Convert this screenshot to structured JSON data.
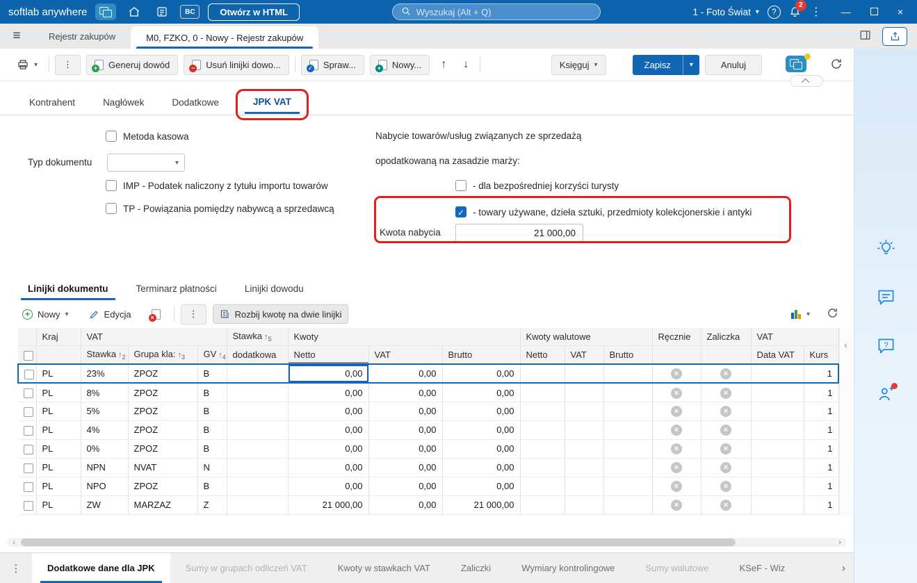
{
  "topbar": {
    "app_name": "softlab anywhere",
    "bc_icon_label": "BC",
    "open_html_label": "Otwórz w HTML",
    "search_placeholder": "Wyszukaj (Alt + Q)",
    "company_selector": "1 - Foto Świat",
    "notification_badge": "2"
  },
  "tabbar": {
    "tab_inactive": "Rejestr zakupów",
    "tab_active": "M0, FZKO, 0 - Nowy - Rejestr zakupów"
  },
  "toolbar": {
    "generuj_dowod": "Generuj dowód",
    "usun_linijki": "Usuń linijki dowo...",
    "sprawdz": "Spraw...",
    "nowy": "Nowy...",
    "ksieguj": "Księguj",
    "zapisz": "Zapisz",
    "anuluj": "Anuluj"
  },
  "form_tabs": {
    "items": [
      "Kontrahent",
      "Nagłówek",
      "Dodatkowe",
      "JPK VAT"
    ],
    "active": "JPK VAT"
  },
  "form": {
    "metoda_kasowa": "Metoda kasowa",
    "typ_dokumentu_label": "Typ dokumentu",
    "imp_label": "IMP - Podatek naliczony z tytułu importu towarów",
    "tp_label": "TP - Powiązania pomiędzy nabywcą a sprzedawcą",
    "marza_line1": "Nabycie towarów/usług związanych ze sprzedażą",
    "marza_line2": "opodatkowaną na zasadzie marży:",
    "turysta_label": "- dla bezpośredniej korzyści turysty",
    "towary_label": "- towary używane, dzieła sztuki, przedmioty kolekcjonerskie i antyki",
    "kwota_nabycia_label": "Kwota nabycia",
    "kwota_nabycia_value": "21 000,00"
  },
  "detail_tabs": {
    "items": [
      "Linijki dokumentu",
      "Terminarz płatności",
      "Linijki dowodu"
    ],
    "active": "Linijki dokumentu"
  },
  "toolbar2": {
    "nowy": "Nowy",
    "edycja": "Edycja",
    "rozbij": "Rozbij kwotę na dwie linijki"
  },
  "table": {
    "groups": {
      "kraj": "Kraj",
      "vat": "VAT",
      "stawka_dod": "Stawka",
      "kwoty": "Kwoty",
      "kwoty_walutowe": "Kwoty walutowe",
      "recznie": "Ręcznie",
      "zaliczka": "Zaliczka",
      "vat_info": "VAT"
    },
    "cols": {
      "stawka": "Stawka",
      "grupa": "Grupa kla:",
      "gv": "GV",
      "dodatkowa": "dodatkowa",
      "netto": "Netto",
      "vat": "VAT",
      "brutto": "Brutto",
      "wal_netto": "Netto",
      "wal_vat": "VAT",
      "wal_brutto": "Brutto",
      "data_vat": "Data VAT",
      "kurs": "Kurs"
    },
    "sort": {
      "stawka": "2",
      "grupa": "3",
      "gv": "4",
      "dodatkowa": "5"
    },
    "rows": [
      {
        "kraj": "PL",
        "stawka": "23%",
        "grupa": "ZPOZ",
        "gv": "B",
        "dodatkowa": "",
        "netto": "0,00",
        "vat": "0,00",
        "brutto": "0,00",
        "wal_netto": "",
        "wal_vat": "",
        "wal_brutto": "",
        "data_vat": "",
        "kurs": "1"
      },
      {
        "kraj": "PL",
        "stawka": "8%",
        "grupa": "ZPOZ",
        "gv": "B",
        "dodatkowa": "",
        "netto": "0,00",
        "vat": "0,00",
        "brutto": "0,00",
        "wal_netto": "",
        "wal_vat": "",
        "wal_brutto": "",
        "data_vat": "",
        "kurs": "1"
      },
      {
        "kraj": "PL",
        "stawka": "5%",
        "grupa": "ZPOZ",
        "gv": "B",
        "dodatkowa": "",
        "netto": "0,00",
        "vat": "0,00",
        "brutto": "0,00",
        "wal_netto": "",
        "wal_vat": "",
        "wal_brutto": "",
        "data_vat": "",
        "kurs": "1"
      },
      {
        "kraj": "PL",
        "stawka": "4%",
        "grupa": "ZPOZ",
        "gv": "B",
        "dodatkowa": "",
        "netto": "0,00",
        "vat": "0,00",
        "brutto": "0,00",
        "wal_netto": "",
        "wal_vat": "",
        "wal_brutto": "",
        "data_vat": "",
        "kurs": "1"
      },
      {
        "kraj": "PL",
        "stawka": "0%",
        "grupa": "ZPOZ",
        "gv": "B",
        "dodatkowa": "",
        "netto": "0,00",
        "vat": "0,00",
        "brutto": "0,00",
        "wal_netto": "",
        "wal_vat": "",
        "wal_brutto": "",
        "data_vat": "",
        "kurs": "1"
      },
      {
        "kraj": "PL",
        "stawka": "NPN",
        "grupa": "NVAT",
        "gv": "N",
        "dodatkowa": "",
        "netto": "0,00",
        "vat": "0,00",
        "brutto": "0,00",
        "wal_netto": "",
        "wal_vat": "",
        "wal_brutto": "",
        "data_vat": "",
        "kurs": "1"
      },
      {
        "kraj": "PL",
        "stawka": "NPO",
        "grupa": "ZPOZ",
        "gv": "B",
        "dodatkowa": "",
        "netto": "0,00",
        "vat": "0,00",
        "brutto": "0,00",
        "wal_netto": "",
        "wal_vat": "",
        "wal_brutto": "",
        "data_vat": "",
        "kurs": "1"
      },
      {
        "kraj": "PL",
        "stawka": "ZW",
        "grupa": "MARZAZ",
        "gv": "Z",
        "dodatkowa": "",
        "netto": "21 000,00",
        "vat": "0,00",
        "brutto": "21 000,00",
        "wal_netto": "",
        "wal_vat": "",
        "wal_brutto": "",
        "data_vat": "",
        "kurs": "1"
      }
    ]
  },
  "bottom_tabs": {
    "items": [
      {
        "label": "Dodatkowe dane dla JPK",
        "active": true
      },
      {
        "label": "Sumy w grupach odliczeń VAT",
        "disabled": true
      },
      {
        "label": "Kwoty w stawkach VAT"
      },
      {
        "label": "Zaliczki"
      },
      {
        "label": "Wymiary kontrolingowe"
      },
      {
        "label": "Sumy walutowe",
        "disabled": true
      },
      {
        "label": "KSeF - Wiz"
      }
    ]
  },
  "icons": {
    "hamburger": "≡",
    "kebab": "⋮",
    "chevron_down": "▾",
    "chevron_left": "‹",
    "chevron_right": "›",
    "arrow_up": "↑",
    "arrow_down": "↓",
    "sort_asc": "↑",
    "clear_x": "×",
    "minimize": "—",
    "close": "×",
    "help": "?"
  },
  "colors": {
    "topbar_blue": "#0d63ac",
    "accent_blue": "#1565c0",
    "annotation_red": "#e0201c",
    "cell_yellow": "#faf7e1",
    "cell_blue": "#d9e4f0",
    "cell_gray": "#d7d7d7",
    "badge_red": "#e53935"
  }
}
